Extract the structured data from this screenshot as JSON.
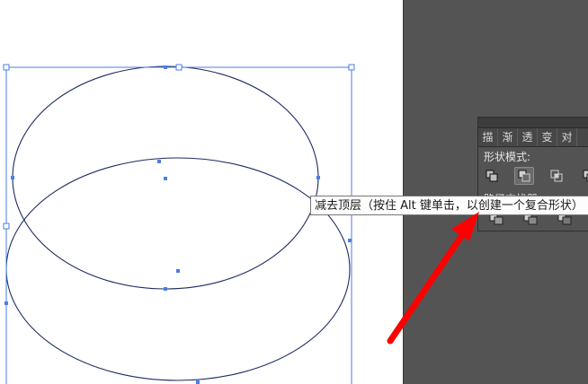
{
  "panel": {
    "tabs": [
      "描",
      "渐",
      "透",
      "变",
      "对"
    ],
    "shape_modes_label": "形状模式:",
    "pathfinder_label": "路径查找器:"
  },
  "tooltip": {
    "text": "减去顶层（按住 Alt 键单击，以创建一个复合形状）"
  },
  "colors": {
    "selection": "#4a7ee8",
    "arrow": "#ff0000",
    "pasteboard": "#545454",
    "panel": "#535353"
  },
  "icons": {
    "shape_modes": [
      "unite-icon",
      "minus-front-icon",
      "intersect-icon",
      "exclude-icon"
    ],
    "pathfinders": [
      "divide-icon",
      "trim-icon",
      "merge-icon"
    ]
  }
}
